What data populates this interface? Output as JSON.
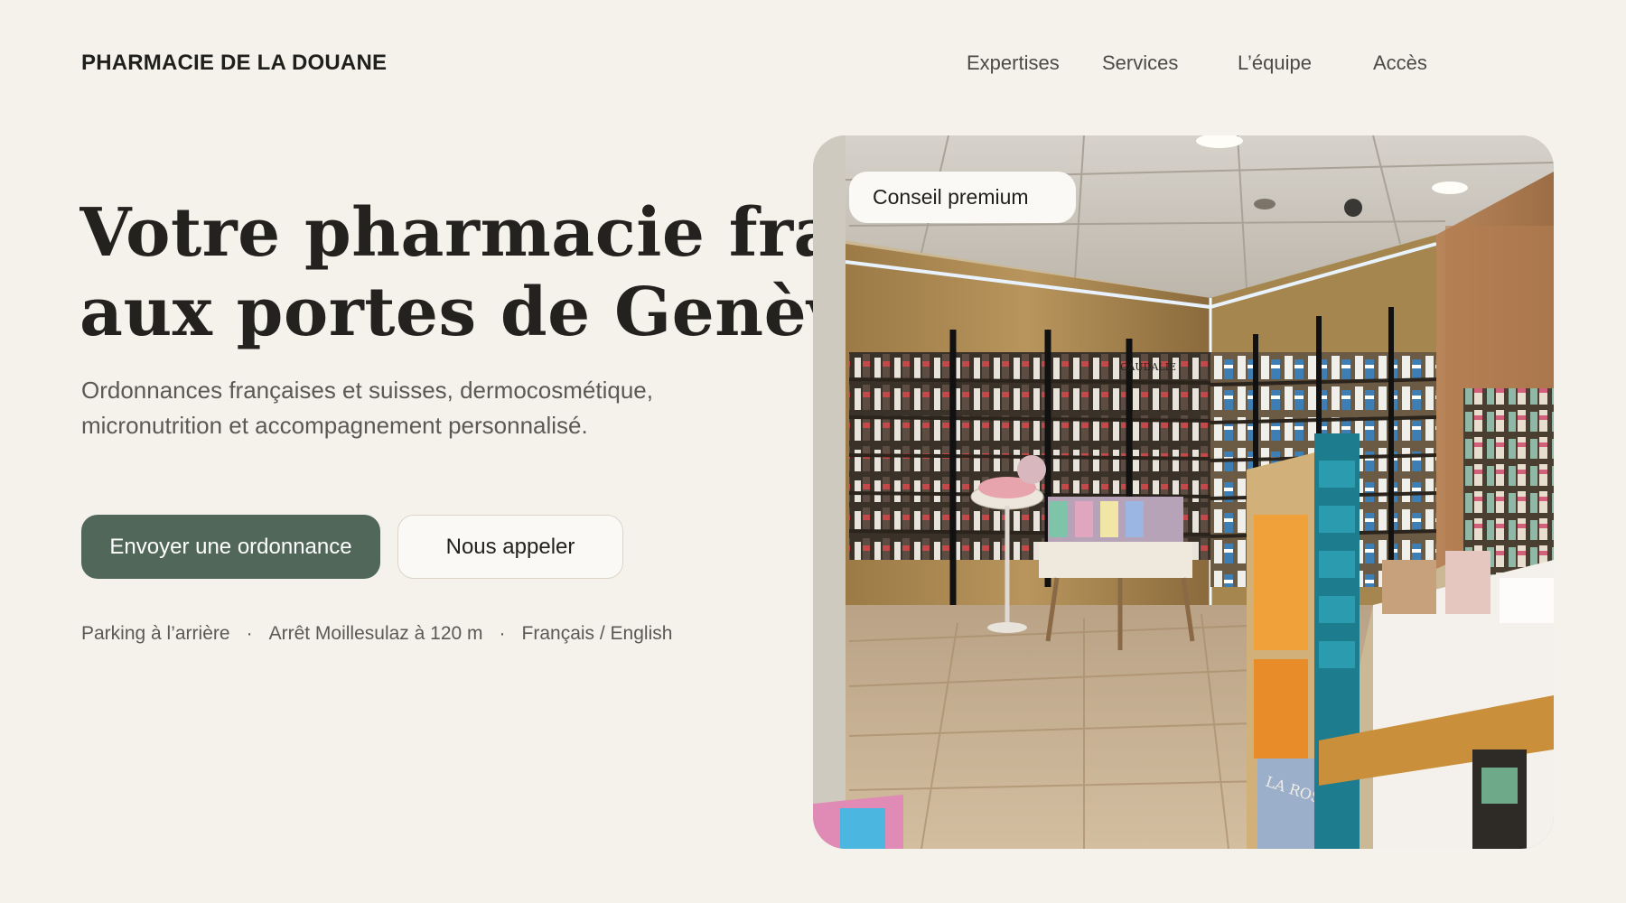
{
  "header": {
    "brand": "PHARMACIE DE LA DOUANE",
    "nav": [
      "Expertises",
      "Services",
      "L’équipe",
      "Accès"
    ]
  },
  "hero": {
    "title_line1": "Votre pharmacie française",
    "title_line2": "aux portes de Genève",
    "subtitle": "Ordonnances françaises et suisses, dermocosmétique, micronutrition et accompagnement personnalisé.",
    "primary_cta": "Envoyer une ordonnance",
    "secondary_cta": "Nous appeler",
    "info": {
      "parking": "Parking à l’arrière",
      "stop": "Arrêt Moillesulaz à 120 m",
      "languages": "Français / English",
      "separator": "·"
    }
  },
  "photo": {
    "badge": "Conseil premium",
    "brand_sign": "CAUDALIE",
    "display_sign": "LA ROSÉE"
  },
  "colors": {
    "background": "#f5f2ec",
    "primary_button": "#51675a",
    "text_dark": "#22221f",
    "text_muted": "#5b5954"
  }
}
